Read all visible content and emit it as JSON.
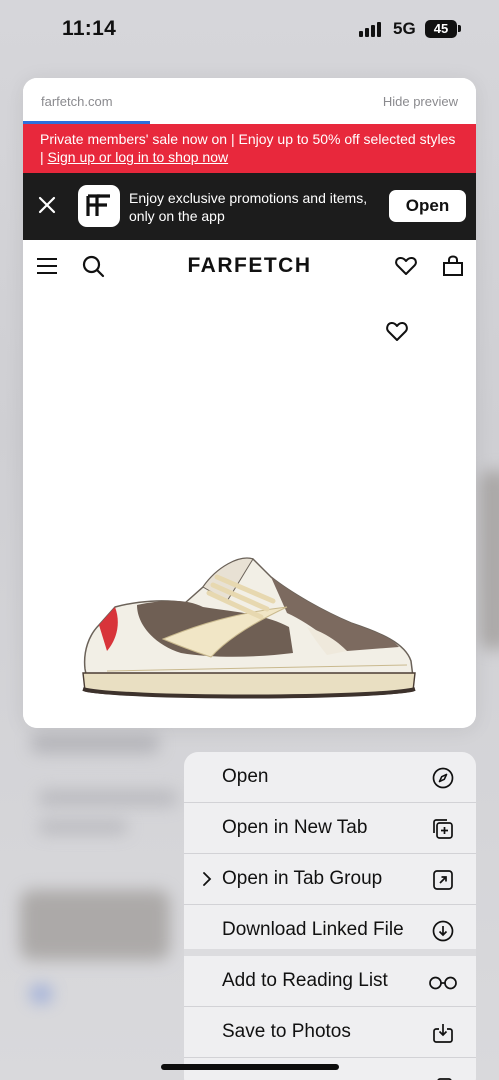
{
  "status_bar": {
    "time": "11:14",
    "network": "5G",
    "battery": "45"
  },
  "preview": {
    "url": "farfetch.com",
    "hide_label": "Hide preview",
    "load_progress": 0.28,
    "promo_text": "Private members' sale now on | Enjoy up to 50% off selected styles | ",
    "promo_link": "Sign up or log in to shop now",
    "app_banner_text": "Enjoy exclusive promotions and items, only on the app",
    "app_open_label": "Open",
    "brand": "FARFETCH"
  },
  "menu": {
    "items": [
      {
        "label": "Open",
        "icon": "compass-icon"
      },
      {
        "label": "Open in New Tab",
        "icon": "new-tab-icon"
      },
      {
        "label": "Open in Tab Group",
        "icon": "tab-group-icon"
      },
      {
        "label": "Download Linked File",
        "icon": "download-icon"
      },
      {
        "label": "Add to Reading List",
        "icon": "glasses-icon"
      },
      {
        "label": "Save to Photos",
        "icon": "save-icon"
      }
    ]
  },
  "colors": {
    "promo": "#e8283c",
    "app_banner": "#1c1c1c",
    "progress": "#2f6fdc"
  }
}
